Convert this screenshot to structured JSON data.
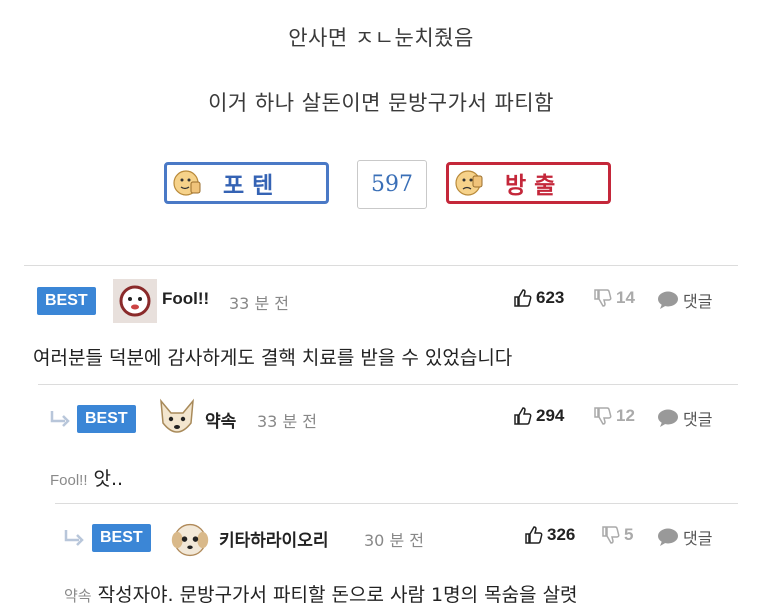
{
  "post": {
    "line1": "안사면 ㅈㄴ눈치줬음",
    "line2": "이거 하나 살돈이면 문방구가서 파티함"
  },
  "votes": {
    "up_label": "포텐",
    "count": "597",
    "down_label": "방출",
    "up_color": "#4a79c6",
    "down_color": "#c4273a"
  },
  "comments": [
    {
      "badge": "BEST",
      "author": "Fool!!",
      "time": "33 분 전",
      "likes": "623",
      "dislikes": "14",
      "reply_label": "댓글",
      "mention": "",
      "text": "여러분들 덕분에 감사하게도 결핵 치료를 받을 수 있었습니다"
    },
    {
      "badge": "BEST",
      "author": "약속",
      "time": "33 분 전",
      "likes": "294",
      "dislikes": "12",
      "reply_label": "댓글",
      "mention": "Fool!!",
      "text": "앗.."
    },
    {
      "badge": "BEST",
      "author": "키타하라이오리",
      "time": "30 분 전",
      "likes": "326",
      "dislikes": "5",
      "reply_label": "댓글",
      "mention": "약속",
      "text": "작성자야. 문방구가서 파티할 돈으로 사람 1명의 목숨을 살렷"
    }
  ],
  "colors": {
    "best_badge": "#3b86d6",
    "icon_gray": "#aaaaaa"
  }
}
